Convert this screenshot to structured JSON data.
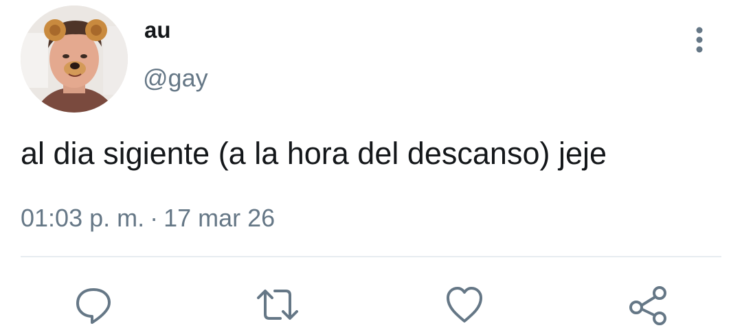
{
  "tweet": {
    "display_name": "au",
    "handle": "@gay",
    "text": "al dia sigiente (a la hora del descanso) jeje",
    "time": "01:03 p. m.",
    "separator": "·",
    "date": "17 mar 26"
  },
  "icons": {
    "avatar": "user-avatar-photo",
    "more": "more-vertical-icon",
    "reply": "reply-icon",
    "retweet": "retweet-icon",
    "like": "heart-icon",
    "share": "share-icon"
  },
  "colors": {
    "text": "#14171a",
    "secondary": "#657786",
    "icon": "#657786",
    "divider": "#e6ecf0"
  }
}
